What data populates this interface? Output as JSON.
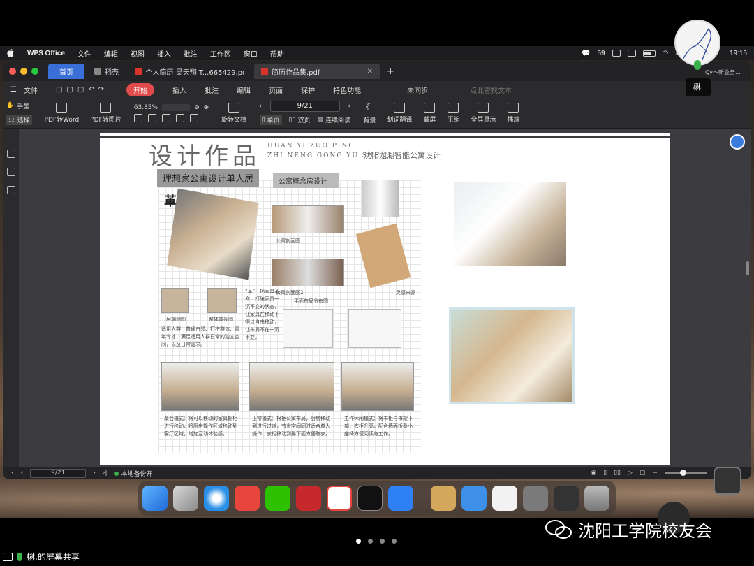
{
  "mac_menubar": {
    "app_name": "WPS Office",
    "items": [
      "文件",
      "编辑",
      "视图",
      "插入",
      "批注",
      "工作区",
      "窗口",
      "帮助"
    ],
    "wechat_count": "59",
    "time": "19:15"
  },
  "tabs": {
    "home": "首页",
    "shell": "稻壳",
    "doc1": "个人简历 吴天翔 T...665429.pdf",
    "doc2": "简历作品集.pdf"
  },
  "menu": {
    "file": "文件",
    "start": "开始",
    "items": [
      "插入",
      "批注",
      "编辑",
      "页面",
      "保护",
      "特色功能"
    ],
    "sync": "未同步",
    "search_placeholder": "点此查找文本"
  },
  "toolbar": {
    "hand": "手型",
    "select": "选择",
    "pdf_to_word": "PDF转Word",
    "pdf_to_image": "PDF转图片",
    "zoom": "63.85%",
    "rotate": "旋转文档",
    "page": "9/21",
    "single": "单页",
    "double": "双页",
    "continuous": "连续阅读",
    "background": "背景",
    "translate": "划词翻译",
    "screenshot": "截屏",
    "compress": "压缩",
    "fullscreen": "全屏显示",
    "play": "播放"
  },
  "document": {
    "title": "设计作品",
    "pinyin_1": "HUAN YI ZUO PING",
    "pinyin_2": "ZHI NENG GONG YU SHE JI",
    "subtitle": "沈阳龙湖智能公寓设计",
    "banner1": "理想家公寓设计单人居",
    "banner2": "公寓概念房设计",
    "ge": "革",
    "cap_section1": "公寓剖面图",
    "cap_section2": "公寓剖面图2",
    "cap_inspiration": "灵感来源",
    "cap_axon": "一层轴测图",
    "cap_overall": "整体效视图",
    "cap_ge": "“革”一扬家具革命，打破家具一沉不变的状态，让家具在移动下得以自由移动，让布局不在一沉不变。",
    "cap_planlabel": "平面布局分布图",
    "cap_users": "适用人群：普通白领、打拼群体、青年专才，满足适用人群日常的独立空间，以及日常需求。",
    "cap_b1": "聚会模式：将可以移动的家具橱柜进行移动，将厨房操作区域移动到客厅区域，增加互动体验感。",
    "cap_b2": "正常模式：根据公寓布局，厨房移动到进行过道，节省空间同时适合单人操作，衣柜移动到最下面方便取衣。",
    "cap_b3": "工作休闲模式：将书柜与书架下部，衣柜升高，配合墙面折叠小座椅方便阅读与工作。"
  },
  "status": {
    "page": "9/21",
    "backup": "本地备份开",
    "zoom": "64"
  },
  "overlay": {
    "speaker_name": "楙.",
    "qy_label": "Qy～新业务...",
    "watermark": "沈阳工学院校友会",
    "share_label": "楙.的屏幕共享"
  },
  "colors": {
    "accent_blue": "#3a6fd8",
    "start_red": "#e04b4b",
    "status_green": "#3ab14a"
  }
}
